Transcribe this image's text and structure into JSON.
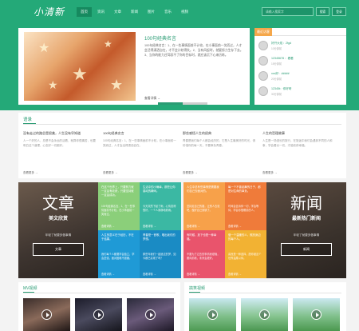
{
  "header": {
    "logo": "小清新",
    "nav": [
      "首页",
      "资讯",
      "文章",
      "新闻",
      "图片",
      "音乐",
      "视频"
    ],
    "search_placeholder": "请输入搜索字",
    "search_btn": "搜索",
    "login_btn": "登录"
  },
  "feature": {
    "title": "100句经典名言",
    "desc": "100句经典名言：1、在一些事情面前不计较，在小事面前一笑而过，人才会活得潇洒自在，才不会计较得失。2、当有风起时，就要努力生存下去。3、当你的能力还驾驭不了你的目标时，就应该沉下心来历练。",
    "more": "查看详情 →",
    "progress": 0.5
  },
  "sidebar": {
    "tab": "最近访客",
    "users": [
      {
        "name": "好开大佑：2fgd",
        "sub": "10分钟前"
      },
      {
        "name": "12345678 ：看看",
        "sub": "15分钟前"
      },
      {
        "name": "xxx好：#####",
        "sub": "20分钟前"
      },
      {
        "name": "12345t：你好呀",
        "sub": "30分钟前"
      }
    ]
  },
  "recommend": {
    "title": "语录",
    "items": [
      {
        "title": "没有走过的路总是很美，人生没有早知道",
        "text": "人一个好的人，总是不会永远的活着，就算你很痛苦，也要明白这个道理，心态好一切都好。",
        "more": "查看更多 →"
      },
      {
        "title": "100句经典名言",
        "text": "100句经典名言：1、在一些事情面前不计较，在小事面前一笑而过，人才会活得潇洒自在。",
        "more": "查看更多 →"
      },
      {
        "title": "那些感悟人生的经典",
        "text": "青春是我们每个人都会经历的，它是人生最美好的时光，请珍惜你的每一天，不要辜负青春。",
        "more": "查看更多 →"
      },
      {
        "title": "人生的哲理故事",
        "text": "人生是一场漫长的旅行，在旅途中我们会遇到不同的人和事，学会看淡一切，才能收获幸福。",
        "more": "查看更多 →"
      }
    ]
  },
  "mosaic": {
    "left": {
      "title": "文章",
      "sub": "美文欣赏",
      "note": "年轻了就要多做事情",
      "btn": "文章"
    },
    "right": {
      "title": "新闻",
      "sub": "最新热门新闻",
      "note": "年轻了就要多做事情",
      "btn": "新闻"
    },
    "cells": [
      {
        "title": "在这个世界上，只要努力就一定会有收获，只要坚持就一定会成功。",
        "text": "100句经典名言，1、在一些事情面前不计较，在小事面前一笑而过。",
        "more": "查看详情 →"
      },
      {
        "title": "生活中的小确幸，那些让你感动的瞬间。",
        "text": "今天突然下起了雨，心情变得很好，一个人静静地看雨。",
        "more": "查看详情 →"
      },
      {
        "title": "人生的意义在于经历，不在于结果。",
        "text": "我们每个人都要学会独立，学会坚强，面对困难不退缩。",
        "more": "查看详情 →"
      },
      {
        "title": "青春是一首歌，唱出我们的梦想。",
        "text": "那些年我们一起追过的梦，如今都已实现了吗？",
        "more": "查看详情 →"
      },
      {
        "title": "人生中总有些事情是需要我们自己去面对的。",
        "text": "坚持走自己的路，让别人去说吧，做好自己就够了。",
        "more": "查看详情 →"
      },
      {
        "title": "每一个不曾起舞的日子，都是对生命的辜负。",
        "text": "时间会告诉你一切，学会等待，学会珍惜眼前的人。",
        "more": "查看详情 →"
      },
      {
        "title": "有时候，放下也是一种幸福。",
        "text": "不要为了过去的事情而烦恼，要向前看，未来会更好。",
        "more": "查看详情 →"
      },
      {
        "title": "做一个温暖的人，照亮身边的每个人。",
        "text": "善良是一种选择，愿你被这个世界温柔以待。",
        "more": "查看详情 →"
      }
    ]
  },
  "videos": {
    "mv_title": "MV视频",
    "fun_title": "搞笑视频"
  },
  "colors": {
    "brand": "#24a978",
    "accent": "#2a9c74",
    "orange": "#f5a74a"
  }
}
